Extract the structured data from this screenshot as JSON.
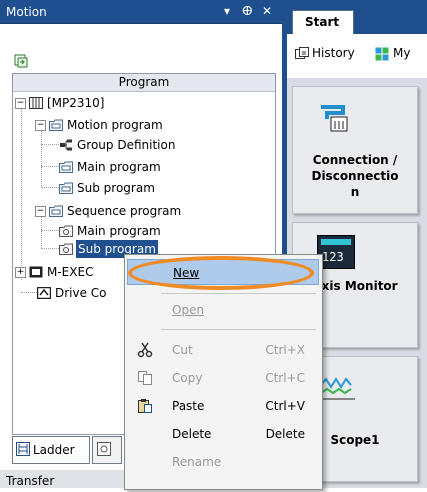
{
  "panel": {
    "title": "Motion",
    "pin_glyph": "▾",
    "autohide_glyph": "ⴲ",
    "close_glyph": "✕"
  },
  "tree": {
    "header": "Program",
    "items": [
      {
        "label": "[MP2310]"
      },
      {
        "label": "Motion program"
      },
      {
        "label": "Group Definition"
      },
      {
        "label": "Main program"
      },
      {
        "label": "Sub program"
      },
      {
        "label": "Sequence program"
      },
      {
        "label": "Main program"
      },
      {
        "label": "Sub program"
      },
      {
        "label": "M-EXEC"
      },
      {
        "label": "Drive Co"
      }
    ]
  },
  "bottom_tabs": [
    {
      "label": "Ladder"
    },
    {
      "label": ""
    }
  ],
  "status": {
    "transfer": "Transfer"
  },
  "right": {
    "start_tab": "Start",
    "toolbar": {
      "history": "History",
      "my": "My"
    },
    "tiles": [
      {
        "label_line1": "Connection /",
        "label_line2": "Disconnectio",
        "label_line3": "n"
      },
      {
        "label": "Axis Monitor",
        "number": "123"
      },
      {
        "label": "Scope1"
      }
    ]
  },
  "context_menu": {
    "items": [
      {
        "label": "New",
        "shortcut": ""
      },
      {
        "label": "Open",
        "shortcut": ""
      },
      {
        "label": "Cut",
        "shortcut": "Ctrl+X"
      },
      {
        "label": "Copy",
        "shortcut": "Ctrl+C"
      },
      {
        "label": "Paste",
        "shortcut": "Ctrl+V"
      },
      {
        "label": "Delete",
        "shortcut": "Delete"
      },
      {
        "label": "Rename",
        "shortcut": ""
      }
    ]
  },
  "colors": {
    "title_bar": "#1f4f8f",
    "selection": "#1f4f8f",
    "menu_highlight": "#aecbeb",
    "annotation_ring": "#f08a24"
  }
}
